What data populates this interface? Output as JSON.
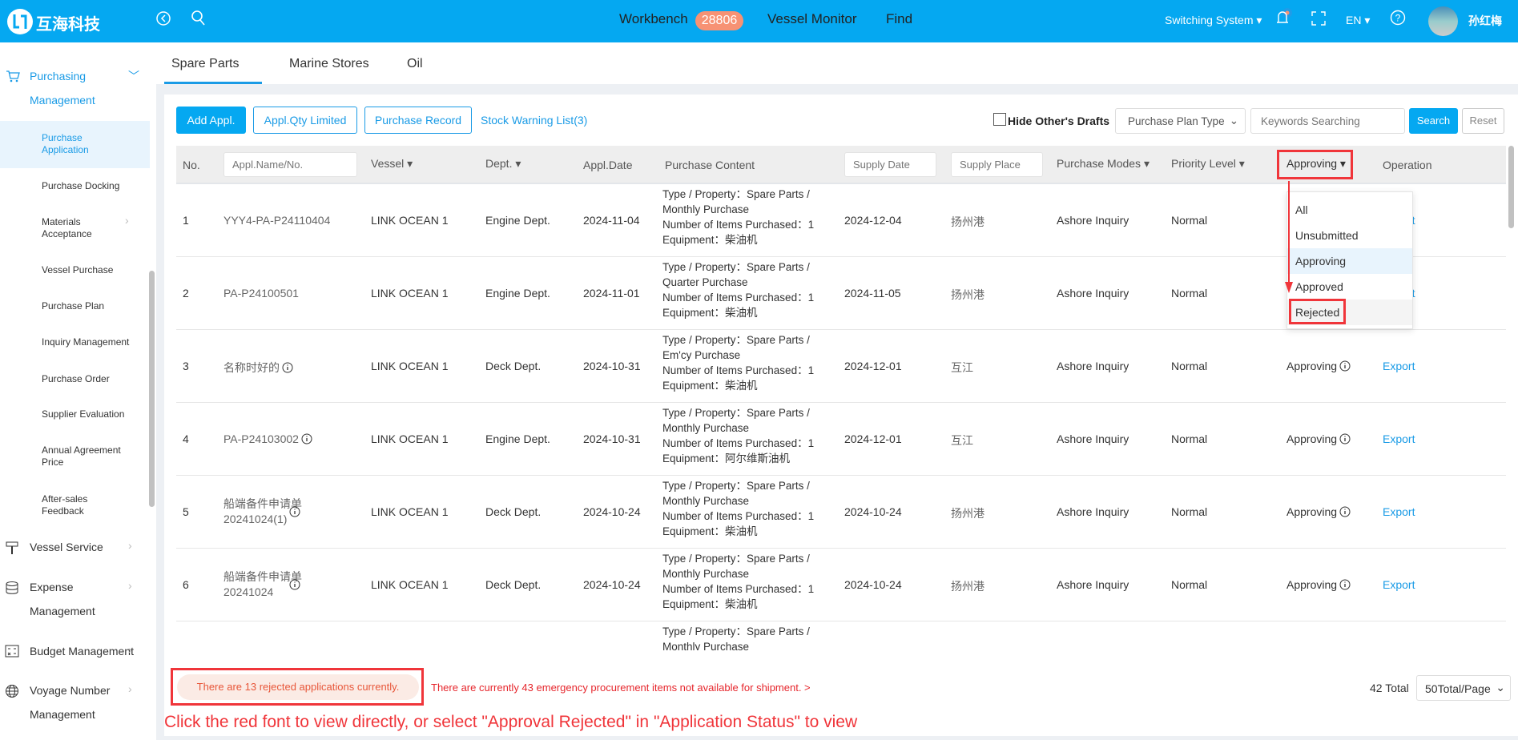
{
  "header": {
    "logo_text": "互海科技",
    "nav": {
      "workbench": "Workbench",
      "workbench_badge": "28806",
      "vessel_monitor": "Vessel Monitor",
      "find": "Find"
    },
    "switching_system": "Switching System",
    "language": "EN",
    "user_name": "孙红梅",
    "brand_color": "#05a8f1"
  },
  "sidebar": {
    "purchasing": "Purchasing",
    "purchasing2": "Management",
    "sub_items": [
      "Purchase Application",
      "Purchase Docking",
      "Materials Acceptance",
      "Vessel Purchase",
      "Purchase Plan",
      "Inquiry Management",
      "Purchase Order",
      "Supplier Evaluation",
      "Annual Agreement Price",
      "After-sales Feedback"
    ],
    "vessel_service": "Vessel Service",
    "expense": "Expense",
    "expense2": "Management",
    "budget": "Budget Management",
    "voyage": "Voyage Number",
    "voyage2": "Management"
  },
  "tabs": [
    "Spare Parts",
    "Marine Stores",
    "Oil"
  ],
  "toolbar": {
    "add": "Add Appl.",
    "qty_limited": "Appl.Qty Limited",
    "purchase_record": "Purchase Record",
    "stock_warning": "Stock Warning List(3)",
    "hide_drafts": "Hide Other's Drafts",
    "plan_type": "Purchase Plan Type",
    "keywords_placeholder": "Keywords Searching",
    "search": "Search",
    "reset": "Reset"
  },
  "table": {
    "headers": {
      "no": "No.",
      "name_placeholder": "Appl.Name/No.",
      "vessel": "Vessel",
      "dept": "Dept.",
      "date": "Appl.Date",
      "content": "Purchase Content",
      "supply_date": "Supply Date",
      "supply_place": "Supply Place",
      "modes": "Purchase Modes",
      "priority": "Priority Level",
      "approving": "Approving",
      "operation": "Operation"
    },
    "rows": [
      {
        "no": "1",
        "name": "YYY4-PA-P24110404",
        "vessel": "LINK OCEAN 1",
        "dept": "Engine Dept.",
        "date": "2024-11-04",
        "type": "Type / Property：Spare Parts / Monthly Purchase",
        "items": "Number of Items Purchased：1",
        "equipment": "Equipment：柴油机",
        "supply_date": "2024-12-04",
        "supply_place": "扬州港",
        "mode": "Ashore Inquiry",
        "priority": "Normal",
        "status": "",
        "operation": "Export"
      },
      {
        "no": "2",
        "name": "PA-P24100501",
        "vessel": "LINK OCEAN 1",
        "dept": "Engine Dept.",
        "date": "2024-11-01",
        "type": "Type / Property：Spare Parts / Quarter Purchase",
        "items": "Number of Items Purchased：1",
        "equipment": "Equipment：柴油机",
        "supply_date": "2024-11-05",
        "supply_place": "扬州港",
        "mode": "Ashore Inquiry",
        "priority": "Normal",
        "status": "",
        "operation": "Export"
      },
      {
        "no": "3",
        "name": "名称时好的",
        "vessel": "LINK OCEAN 1",
        "dept": "Deck Dept.",
        "date": "2024-10-31",
        "type": "Type / Property：Spare Parts / Em'cy Purchase",
        "items": "Number of Items Purchased：1",
        "equipment": "Equipment：柴油机",
        "supply_date": "2024-12-01",
        "supply_place": "互江",
        "mode": "Ashore Inquiry",
        "priority": "Normal",
        "status": "Approving",
        "operation": "Export"
      },
      {
        "no": "4",
        "name": "PA-P24103002",
        "vessel": "LINK OCEAN 1",
        "dept": "Engine Dept.",
        "date": "2024-10-31",
        "type": "Type / Property：Spare Parts / Monthly Purchase",
        "items": "Number of Items Purchased：1",
        "equipment": "Equipment：阿尔维斯油机",
        "supply_date": "2024-12-01",
        "supply_place": "互江",
        "mode": "Ashore Inquiry",
        "priority": "Normal",
        "status": "Approving",
        "operation": "Export"
      },
      {
        "no": "5",
        "name": "船端备件申请单20241024(1)",
        "vessel": "LINK OCEAN 1",
        "dept": "Deck Dept.",
        "date": "2024-10-24",
        "type": "Type / Property：Spare Parts / Monthly Purchase",
        "items": "Number of Items Purchased：1",
        "equipment": "Equipment：柴油机",
        "supply_date": "2024-10-24",
        "supply_place": "扬州港",
        "mode": "Ashore Inquiry",
        "priority": "Normal",
        "status": "Approving",
        "operation": "Export"
      },
      {
        "no": "6",
        "name": "船端备件申请单20241024",
        "vessel": "LINK OCEAN 1",
        "dept": "Deck Dept.",
        "date": "2024-10-24",
        "type": "Type / Property：Spare Parts / Monthly Purchase",
        "items": "Number of Items Purchased：1",
        "equipment": "Equipment：柴油机",
        "supply_date": "2024-10-24",
        "supply_place": "扬州港",
        "mode": "Ashore Inquiry",
        "priority": "Normal",
        "status": "Approving",
        "operation": "Export"
      },
      {
        "no": "",
        "name": "",
        "vessel": "",
        "dept": "",
        "date": "",
        "type": "Type / Property：Spare Parts / Monthly Purchase",
        "items": "",
        "equipment": "",
        "supply_date": "",
        "supply_place": "",
        "mode": "",
        "priority": "",
        "status": "",
        "operation": ""
      }
    ]
  },
  "status_dropdown": {
    "options": [
      "All",
      "Unsubmitted",
      "Approving",
      "Approved",
      "Rejected"
    ],
    "highlighted": "Approving"
  },
  "footer": {
    "rejected_notice": "There are 13 rejected applications currently.",
    "emergency_notice": "There are currently 43 emergency procurement items not available for shipment.  >",
    "total": "42 Total",
    "page_size": "50Total/Page"
  },
  "annotation": "Click the red font to view directly, or select \"Approval Rejected\" in \"Application Status\" to view"
}
